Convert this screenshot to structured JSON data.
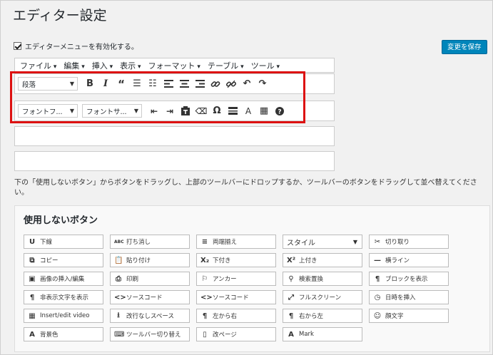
{
  "page_title": "エディター設定",
  "enable_label": "エディターメニューを有効化する。",
  "save_label": "変更を保存",
  "menubar": [
    "ファイル",
    "編集",
    "挿入",
    "表示",
    "フォーマット",
    "テーブル",
    "ツール"
  ],
  "toolbar1": {
    "format_select": "段落",
    "icons": [
      "bold-icon",
      "italic-icon",
      "blockquote-icon",
      "bullet-list-icon",
      "numbered-list-icon",
      "align-left-icon",
      "align-center-icon",
      "align-right-icon",
      "link-icon",
      "unlink-icon",
      "undo-icon",
      "redo-icon"
    ]
  },
  "toolbar2": {
    "font_family_select": "フォントフ...",
    "font_size_select": "フォントサ...",
    "icons": [
      "outdent-icon",
      "indent-icon",
      "paste-text-icon",
      "clear-format-icon",
      "special-char-icon",
      "horizontal-line-icon",
      "text-color-icon",
      "table-icon",
      "help-icon"
    ]
  },
  "instructions": "下の「使用しないボタン」からボタンをドラッグし、上部のツールバーにドロップするか、ツールバーのボタンをドラッグして並べ替えてください。",
  "unused": {
    "title": "使用しないボタン",
    "buttons": [
      {
        "icon": "U",
        "label": "下線"
      },
      {
        "icon": "ABC",
        "label": "打ち消し"
      },
      {
        "icon": "≡",
        "label": "両端揃え"
      },
      {
        "icon": "",
        "label": "スタイル"
      },
      {
        "icon": "✂",
        "label": "切り取り"
      },
      {
        "icon": "⧉",
        "label": "コピー"
      },
      {
        "icon": "📋",
        "label": "貼り付け"
      },
      {
        "icon": "X₂",
        "label": "下付き"
      },
      {
        "icon": "X²",
        "label": "上付き"
      },
      {
        "icon": "—",
        "label": "横ライン"
      },
      {
        "icon": "▣",
        "label": "画像の挿入/編集"
      },
      {
        "icon": "⎙",
        "label": "印刷"
      },
      {
        "icon": "⚐",
        "label": "アンカー"
      },
      {
        "icon": "⚲",
        "label": "検索置換"
      },
      {
        "icon": "¶",
        "label": "ブロックを表示"
      },
      {
        "icon": "¶",
        "label": "非表示文字を表示"
      },
      {
        "icon": "<>",
        "label": "ソースコード"
      },
      {
        "icon": "<>",
        "label": "ソースコード"
      },
      {
        "icon": "⤢",
        "label": "フルスクリーン"
      },
      {
        "icon": "◷",
        "label": "日時を挿入"
      },
      {
        "icon": "▦",
        "label": "Insert/edit video"
      },
      {
        "icon": "⭳",
        "label": "改行なしスペース"
      },
      {
        "icon": "¶",
        "label": "左から右"
      },
      {
        "icon": "¶",
        "label": "右から左"
      },
      {
        "icon": "☺",
        "label": "顔文字"
      },
      {
        "icon": "A",
        "label": "背景色"
      },
      {
        "icon": "⌨",
        "label": "ツールバー切り替え"
      },
      {
        "icon": "▯",
        "label": "改ページ"
      },
      {
        "icon": "A",
        "label": "Mark"
      }
    ]
  },
  "colors": {
    "accent": "#0085ba",
    "highlight": "#dd1111"
  }
}
